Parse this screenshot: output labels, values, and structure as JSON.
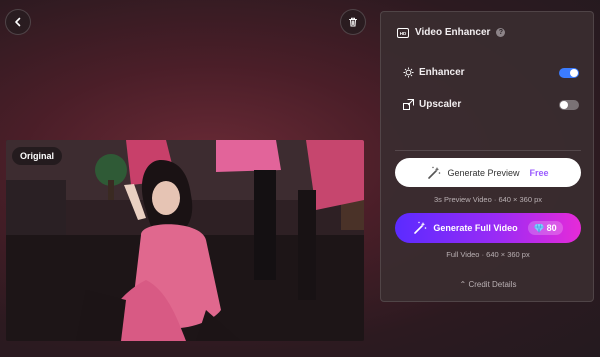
{
  "panel": {
    "title": "Video Enhancer",
    "help": "?",
    "enhancer": {
      "label": "Enhancer",
      "state": "on"
    },
    "upscaler": {
      "label": "Upscaler",
      "state": "off"
    },
    "generate_preview": {
      "label": "Generate Preview",
      "badge": "Free"
    },
    "preview_caption": "3s Preview Video · 640 × 360 px",
    "generate_full": {
      "label": "Generate Full Video",
      "credits": "80"
    },
    "full_caption": "Full Video · 640 × 360 px",
    "credit_details": "Credit Details",
    "accent_color": "#3b7cff"
  },
  "video": {
    "badge": "Original"
  },
  "icons": {
    "back": "chevron-left-icon",
    "trash": "trash-icon",
    "enhancer": "sparkle-sun-icon",
    "upscaler": "upscale-icon",
    "wand": "magic-wand-icon",
    "gem": "gem-icon",
    "chevron_up": "chevron-up-icon"
  }
}
